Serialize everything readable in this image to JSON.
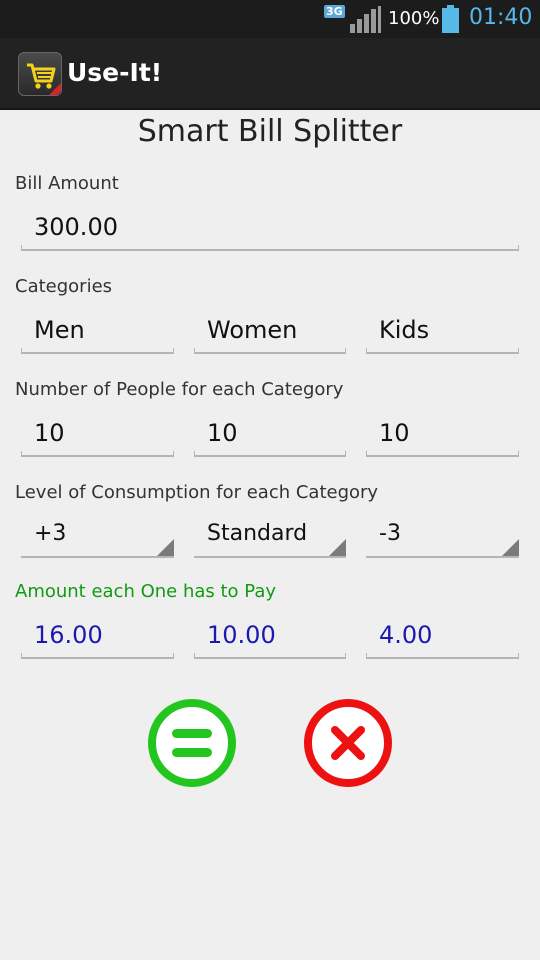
{
  "status_bar": {
    "network": "3G",
    "battery_percent": "100%",
    "time": "01:40",
    "accent_color": "#57b9e8"
  },
  "action_bar": {
    "app_title": "Use-It!",
    "app_icon": "shopping-cart-icon"
  },
  "page": {
    "title": "Smart Bill Splitter"
  },
  "bill": {
    "label": "Bill Amount",
    "value": "300.00"
  },
  "categories": {
    "label": "Categories",
    "items": [
      "Men",
      "Women",
      "Kids"
    ]
  },
  "people": {
    "label": "Number of People for each Category",
    "values": [
      "10",
      "10",
      "10"
    ]
  },
  "consumption": {
    "label": "Level of Consumption for each Category",
    "values": [
      "+3",
      "Standard",
      "-3"
    ]
  },
  "amounts": {
    "label": "Amount each One has to Pay",
    "label_color": "#139a13",
    "value_color": "#1a1ab0",
    "values": [
      "16.00",
      "10.00",
      "4.00"
    ]
  },
  "buttons": {
    "calculate": {
      "icon": "equals-icon",
      "color": "#23c61e"
    },
    "clear": {
      "icon": "x-icon",
      "color": "#ee1111"
    }
  }
}
